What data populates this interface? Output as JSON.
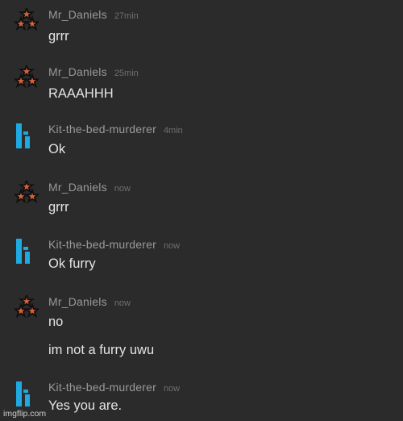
{
  "messages": [
    {
      "user": "Mr_Daniels",
      "avatar": "stars-avatar-icon",
      "time": "27min",
      "lines": [
        "grrr"
      ]
    },
    {
      "user": "Mr_Daniels",
      "avatar": "stars-avatar-icon",
      "time": "25min",
      "lines": [
        "RAAAHHH"
      ]
    },
    {
      "user": "Kit-the-bed-murderer",
      "avatar": "kit-logo-icon",
      "time": "4min",
      "lines": [
        "Ok"
      ]
    },
    {
      "user": "Mr_Daniels",
      "avatar": "stars-avatar-icon",
      "time": "now",
      "lines": [
        "grrr"
      ]
    },
    {
      "user": "Kit-the-bed-murderer",
      "avatar": "kit-logo-icon",
      "time": "now",
      "lines": [
        "Ok furry"
      ]
    },
    {
      "user": "Mr_Daniels",
      "avatar": "stars-avatar-icon",
      "time": "now",
      "lines": [
        "no",
        "im not a furry uwu"
      ]
    },
    {
      "user": "Kit-the-bed-murderer",
      "avatar": "kit-logo-icon",
      "time": "now",
      "lines": [
        "Yes you are."
      ]
    }
  ],
  "watermark": "imgflip.com",
  "colors": {
    "background": "#2b2b2b",
    "kit_logo": "#1fa9e1",
    "stars_fill": "#d9623a",
    "stars_outline": "#111111"
  }
}
